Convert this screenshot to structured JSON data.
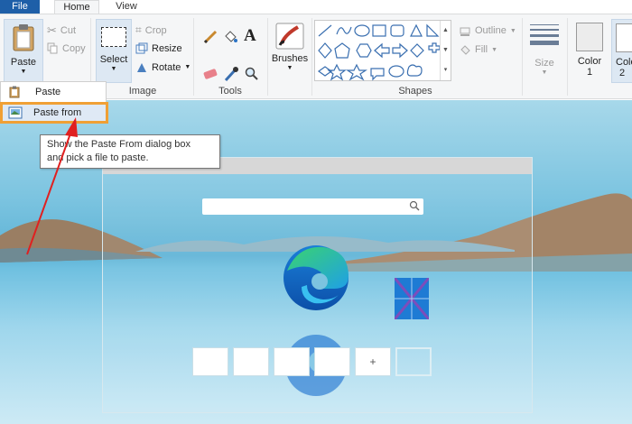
{
  "tabs": {
    "file": "File",
    "home": "Home",
    "view": "View"
  },
  "clipboard": {
    "paste": "Paste",
    "cut": "Cut",
    "copy": "Copy"
  },
  "image": {
    "select": "Select",
    "crop": "Crop",
    "resize": "Resize",
    "rotate": "Rotate",
    "label": "Image"
  },
  "tools": {
    "label": "Tools"
  },
  "brushes": {
    "label": "Brushes"
  },
  "shapes": {
    "label": "Shapes",
    "outline": "Outline",
    "fill": "Fill"
  },
  "size": {
    "label": "Size"
  },
  "colors": {
    "color1_line1": "Color",
    "color1_line2": "1",
    "color2_line1": "Colo",
    "color2_line2": "2"
  },
  "paste_menu": {
    "paste": "Paste",
    "paste_from": "Paste from"
  },
  "tooltip": {
    "line1": "Show the Paste From dialog box",
    "line2": "and pick a file to paste."
  },
  "new_tab_tile_add": "+",
  "colors_accent": {
    "file_tab": "#1e5fa8",
    "highlight": "#f0a035",
    "arrow": "#e02020"
  }
}
